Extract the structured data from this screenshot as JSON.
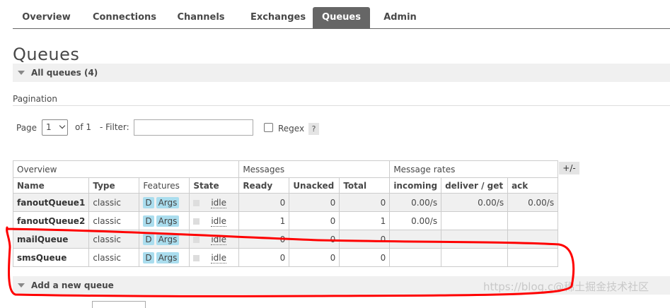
{
  "tabs": [
    {
      "label": "Overview"
    },
    {
      "label": "Connections"
    },
    {
      "label": "Channels"
    },
    {
      "label": "Exchanges"
    },
    {
      "label": "Queues"
    },
    {
      "label": "Admin"
    }
  ],
  "active_tab": "Queues",
  "page_title": "Queues",
  "all_queues_label": "All queues (4)",
  "pagination": {
    "section_label": "Pagination",
    "page_label": "Page",
    "page_value": "1",
    "of_label": "of 1",
    "filter_label": "- Filter:",
    "filter_value": "",
    "regex_label": "Regex",
    "help_label": "?"
  },
  "table": {
    "groups": [
      "Overview",
      "Messages",
      "Message rates"
    ],
    "columns": [
      "Name",
      "Type",
      "Features",
      "State",
      "Ready",
      "Unacked",
      "Total",
      "incoming",
      "deliver / get",
      "ack"
    ],
    "toggle_columns_label": "+/-",
    "rows": [
      {
        "name": "fanoutQueue1",
        "type": "classic",
        "features": [
          "D",
          "Args"
        ],
        "state": "idle",
        "ready": "0",
        "unacked": "0",
        "total": "0",
        "incoming": "0.00/s",
        "deliver_get": "0.00/s",
        "ack": "0.00/s"
      },
      {
        "name": "fanoutQueue2",
        "type": "classic",
        "features": [
          "D",
          "Args"
        ],
        "state": "idle",
        "ready": "1",
        "unacked": "0",
        "total": "1",
        "incoming": "0.00/s",
        "deliver_get": "",
        "ack": ""
      },
      {
        "name": "mailQueue",
        "type": "classic",
        "features": [
          "D",
          "Args"
        ],
        "state": "idle",
        "ready": "0",
        "unacked": "0",
        "total": "0",
        "incoming": "",
        "deliver_get": "",
        "ack": ""
      },
      {
        "name": "smsQueue",
        "type": "classic",
        "features": [
          "D",
          "Args"
        ],
        "state": "idle",
        "ready": "0",
        "unacked": "0",
        "total": "0",
        "incoming": "",
        "deliver_get": "",
        "ack": ""
      }
    ]
  },
  "add_queue_label": "Add a new queue",
  "watermark": "https://blog.c@稀土掘金技术社区",
  "colors": {
    "tab_active_bg": "#666666",
    "feature_badge": "#aaddee",
    "annotation": "#ff0000"
  }
}
